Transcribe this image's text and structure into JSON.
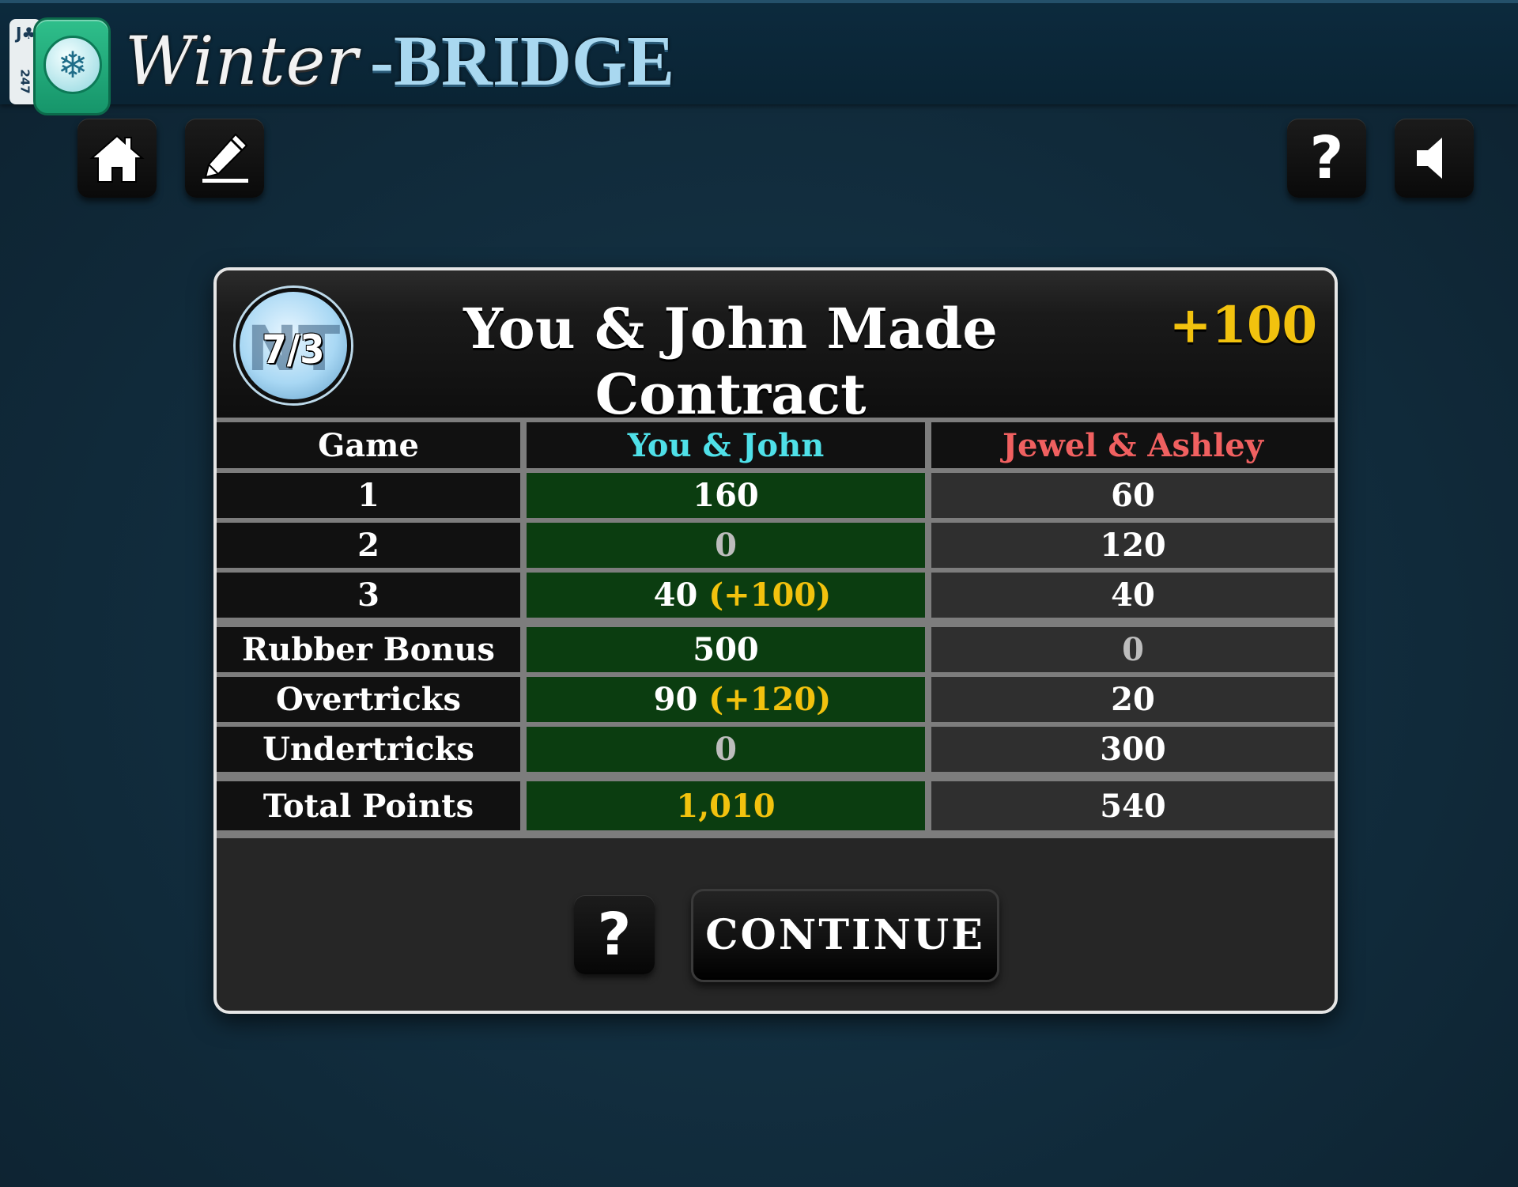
{
  "app": {
    "logo_card_rank": "J♣",
    "logo_card_number": "247",
    "title_part1": "Winter",
    "title_part2": "-BRIDGE",
    "logo_icon": "snowflake-icon"
  },
  "toolbar": {
    "left": [
      "home-icon",
      "pencil-icon"
    ],
    "right": [
      "help-icon",
      "speaker-icon"
    ],
    "help_glyph": "?"
  },
  "dialog": {
    "contract_suit": "NT",
    "contract_tricks": "7/3",
    "title": "You & John Made Contract",
    "points": "+100",
    "table": {
      "headers": [
        "Game",
        "You & John",
        "Jewel & Ashley"
      ],
      "rows": [
        {
          "label": "1",
          "us": "160",
          "us_extra": "",
          "them": "60"
        },
        {
          "label": "2",
          "us": "0",
          "us_extra": "",
          "them": "120"
        },
        {
          "label": "3",
          "us": "40",
          "us_extra": "(+100)",
          "them": "40"
        },
        {
          "label": "Rubber Bonus",
          "us": "500",
          "us_extra": "",
          "them": "0"
        },
        {
          "label": "Overtricks",
          "us": "90",
          "us_extra": "(+120)",
          "them": "20"
        },
        {
          "label": "Undertricks",
          "us": "0",
          "us_extra": "",
          "them": "300"
        },
        {
          "label": "Total Points",
          "us": "1,010",
          "us_extra": "",
          "them": "540"
        }
      ]
    },
    "help_label": "?",
    "continue_label": "CONTINUE"
  },
  "colors": {
    "us_header": "#4fe0e8",
    "them_header": "#f06060",
    "highlight": "#f2c20e",
    "us_column_bg": "#0b3d10"
  }
}
